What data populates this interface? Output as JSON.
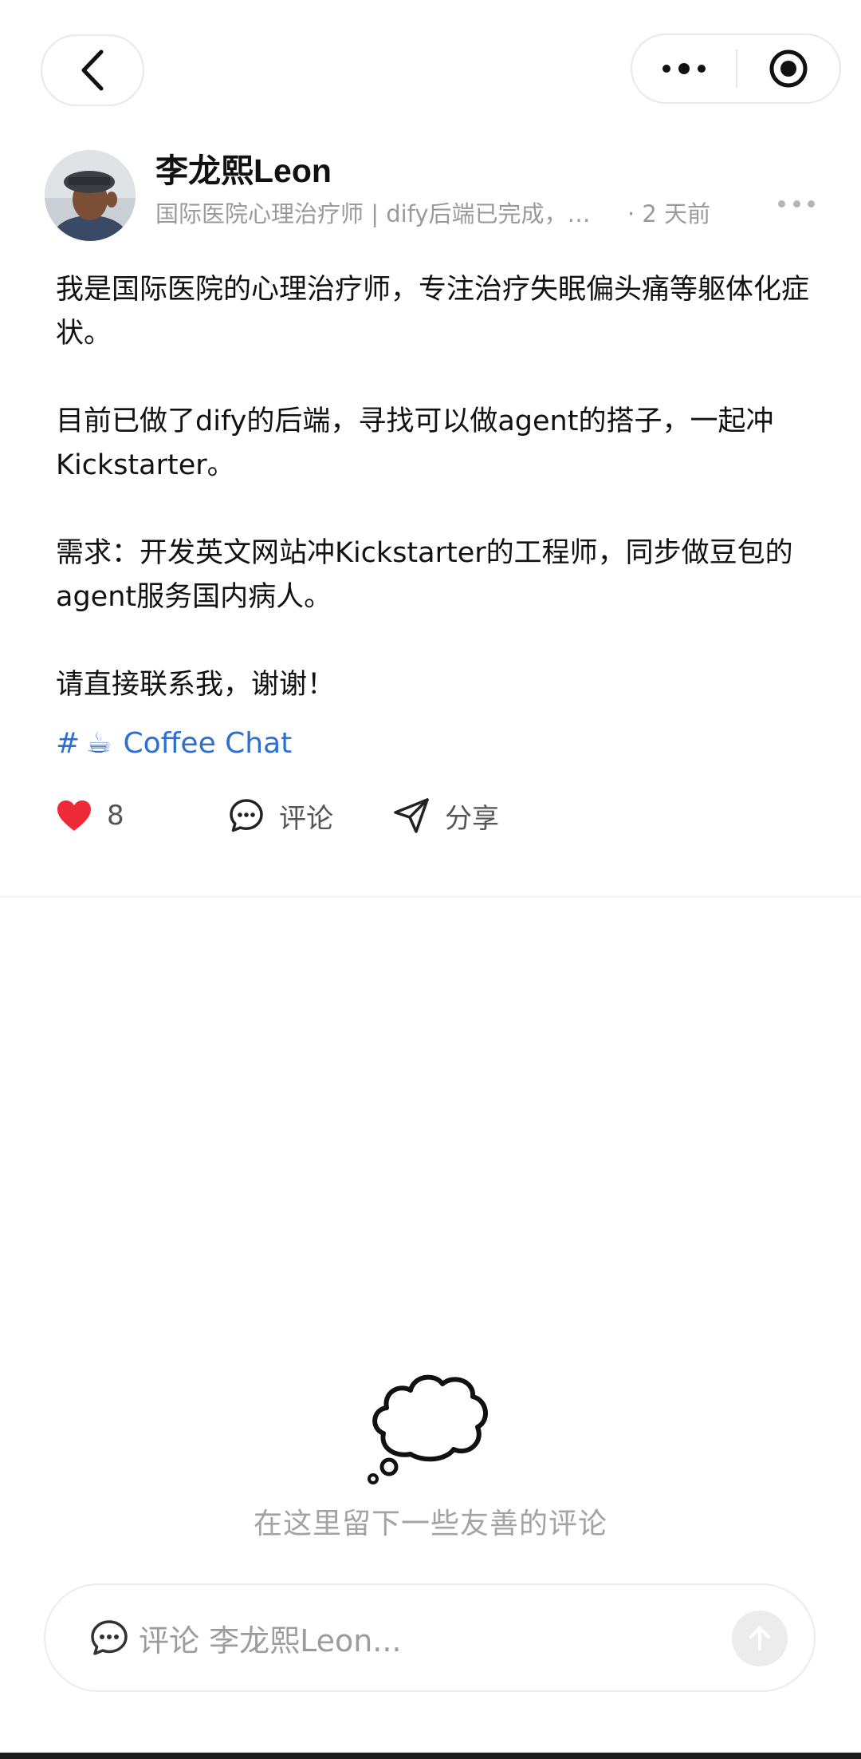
{
  "header": {
    "back_icon": "chevron-left-icon",
    "more_icon": "more-dots-icon",
    "target_icon": "target-circle-icon"
  },
  "author": {
    "name": "李龙熙Leon",
    "bio": "国际医院心理治疗师 | dify后端已完成，…",
    "time": "· 2 天前"
  },
  "post": {
    "paragraphs": [
      "我是国际医院的心理治疗师，专注治疗失眠偏头痛等躯体化症状。",
      "目前已做了dify的后端，寻找可以做agent的搭子，一起冲Kickstarter。",
      "需求：开发英文网站冲Kickstarter的工程师，同步做豆包的agent服务国内病人。",
      "请直接联系我，谢谢！"
    ],
    "tag_hash": "#",
    "tag_emoji": "☕",
    "tag_label": "Coffee Chat"
  },
  "actions": {
    "like_count": "8",
    "comment_label": "评论",
    "share_label": "分享"
  },
  "comments": {
    "empty_text": "在这里留下一些友善的评论",
    "input_placeholder": "评论 李龙熙Leon..."
  },
  "colors": {
    "accent_link": "#2b6fd6",
    "like_red": "#ee2a38",
    "muted_text": "#9a9a9a"
  }
}
